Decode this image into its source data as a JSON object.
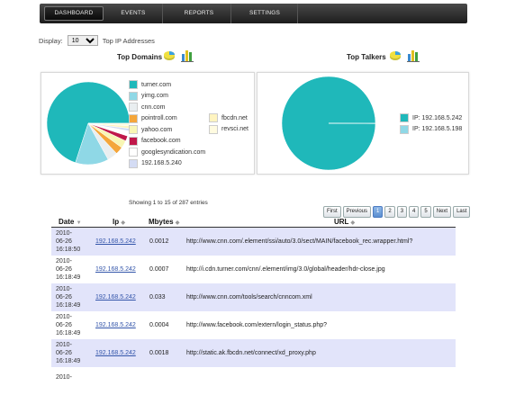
{
  "nav": {
    "items": [
      {
        "label": "DASHBOARD",
        "active": true
      },
      {
        "label": "EVENTS",
        "active": false
      },
      {
        "label": "REPORTS",
        "active": false
      },
      {
        "label": "SETTINGS",
        "active": false
      }
    ]
  },
  "display": {
    "label": "Display:",
    "value": "10",
    "options": [
      "10"
    ],
    "suffix": "Top IP Addresses"
  },
  "domains": {
    "title": "Top Domains",
    "legend": [
      "turner.com",
      "yimg.com",
      "cnn.com",
      "pointroll.com",
      "yahoo.com",
      "facebook.com",
      "googlesyndication.com",
      "192.168.5.240",
      "fbcdn.net",
      "revsci.net"
    ],
    "colors": [
      "#1fb8ba",
      "#8fd8e6",
      "#e9eef0",
      "#f4a63a",
      "#f8f6b4",
      "#c0184a",
      "#ffffff",
      "#d4dcf4",
      "#fff4c0",
      "#fffbe0"
    ]
  },
  "talkers": {
    "title": "Top Talkers",
    "legend": [
      "IP: 192.168.5.242",
      "IP: 192.168.5.198"
    ],
    "colors": [
      "#1fb8ba",
      "#8fd8e6"
    ]
  },
  "chart_data": [
    {
      "type": "pie",
      "title": "Top Domains",
      "labels": [
        "turner.com",
        "yimg.com",
        "cnn.com",
        "pointroll.com",
        "yahoo.com",
        "facebook.com",
        "googlesyndication.com",
        "192.168.5.240",
        "fbcdn.net",
        "revsci.net"
      ],
      "values": [
        70,
        13,
        4,
        3,
        3,
        2,
        2,
        1,
        1,
        1
      ]
    },
    {
      "type": "pie",
      "title": "Top Talkers",
      "labels": [
        "IP: 192.168.5.242",
        "IP: 192.168.5.198"
      ],
      "values": [
        99.9,
        0.1
      ]
    }
  ],
  "table": {
    "info": "Showing 1 to 15 of 287 entries",
    "pager": {
      "first": "First",
      "previous": "Previous",
      "pages": [
        "1",
        "2",
        "3",
        "4",
        "5"
      ],
      "current": "1",
      "next": "Next",
      "last": "Last"
    },
    "columns": [
      "Date",
      "Ip",
      "Mbytes",
      "URL"
    ],
    "rows": [
      {
        "date": [
          "2010-",
          "06-26",
          "16:18:50"
        ],
        "ip": "192.168.5.242",
        "mbytes": "0.0012",
        "url": "http://www.cnn.com/.element/ssi/auto/3.0/sect/MAIN/facebook_rec.wrapper.html?"
      },
      {
        "date": [
          "2010-",
          "06-26",
          "16:18:49"
        ],
        "ip": "192.168.5.242",
        "mbytes": "0.0007",
        "url": "http://i.cdn.turner.com/cnn/.element/img/3.0/global/header/hdr-close.jpg"
      },
      {
        "date": [
          "2010-",
          "06-26",
          "16:18:49"
        ],
        "ip": "192.168.5.242",
        "mbytes": "0.033",
        "url": "http://www.cnn.com/tools/search/cnncom.xml"
      },
      {
        "date": [
          "2010-",
          "06-26",
          "16:18:49"
        ],
        "ip": "192.168.5.242",
        "mbytes": "0.0004",
        "url": "http://www.facebook.com/extern/login_status.php?"
      },
      {
        "date": [
          "2010-",
          "06-26",
          "16:18:49"
        ],
        "ip": "192.168.5.242",
        "mbytes": "0.0018",
        "url": "http://static.ak.fbcdn.net/connect/xd_proxy.php"
      },
      {
        "date": [
          "2010-",
          "",
          ""
        ],
        "ip": "",
        "mbytes": "",
        "url": ""
      }
    ]
  }
}
